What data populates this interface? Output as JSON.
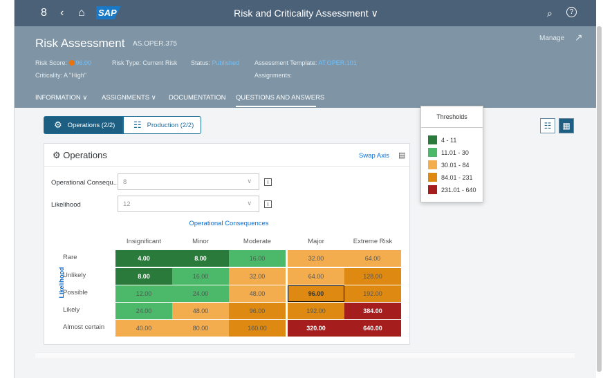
{
  "shell": {
    "title": "Risk and Criticality Assessment ∨",
    "logo": "SAP",
    "icons": [
      "user-icon",
      "back-icon",
      "home-icon",
      "search-icon",
      "help-icon"
    ]
  },
  "header": {
    "title": "Risk Assessment",
    "id": "AS.OPER.375",
    "manage": "Manage",
    "risk_score_label": "Risk Score:",
    "risk_score_value": "96.00",
    "risk_type": "Risk Type: Current Risk",
    "status_label": "Status:",
    "status_value": "Published",
    "template_label": "Assessment Template:",
    "template_value": "AT.OPER.101",
    "criticality": "Criticality: A \"High\"",
    "assignments": "Assignments:"
  },
  "tabs": [
    "INFORMATION ∨",
    "ASSIGNMENTS ∨",
    "DOCUMENTATION",
    "QUESTIONS AND ANSWERS"
  ],
  "segments": [
    "Operations (2/2)",
    "Production (2/2)"
  ],
  "card": {
    "title": "Operations",
    "swap_axis": "Swap Axis",
    "field1_label": "Operational Consequ...",
    "field1_value": "8",
    "field2_label": "Likelihood",
    "field2_value": "12"
  },
  "chart_data": {
    "type": "heatmap",
    "x_title": "Operational Consequences",
    "y_title": "Likelihood",
    "columns": [
      "Insignificant",
      "Minor",
      "Moderate",
      "Major",
      "Extreme Risk"
    ],
    "rows": [
      "Rare",
      "Unlikely",
      "Possible",
      "Likely",
      "Almost certain"
    ],
    "values": [
      [
        "4.00",
        "8.00",
        "16.00",
        "32.00",
        "64.00"
      ],
      [
        "8.00",
        "16.00",
        "32.00",
        "64.00",
        "128.00"
      ],
      [
        "12.00",
        "24.00",
        "48.00",
        "96.00",
        "192.00"
      ],
      [
        "24.00",
        "48.00",
        "96.00",
        "192.00",
        "384.00"
      ],
      [
        "40.00",
        "80.00",
        "160.00",
        "320.00",
        "640.00"
      ]
    ],
    "selected": "96.00"
  },
  "thresholds": {
    "title": "Thresholds",
    "items": [
      {
        "label": "4 - 11",
        "color": "#2a7a3b"
      },
      {
        "label": "11.01 - 30",
        "color": "#4cb86a"
      },
      {
        "label": "30.01 - 84",
        "color": "#f3ad4f"
      },
      {
        "label": "84.01 - 231",
        "color": "#de8a12"
      },
      {
        "label": "231.01 - 640",
        "color": "#a51d1d"
      }
    ]
  }
}
